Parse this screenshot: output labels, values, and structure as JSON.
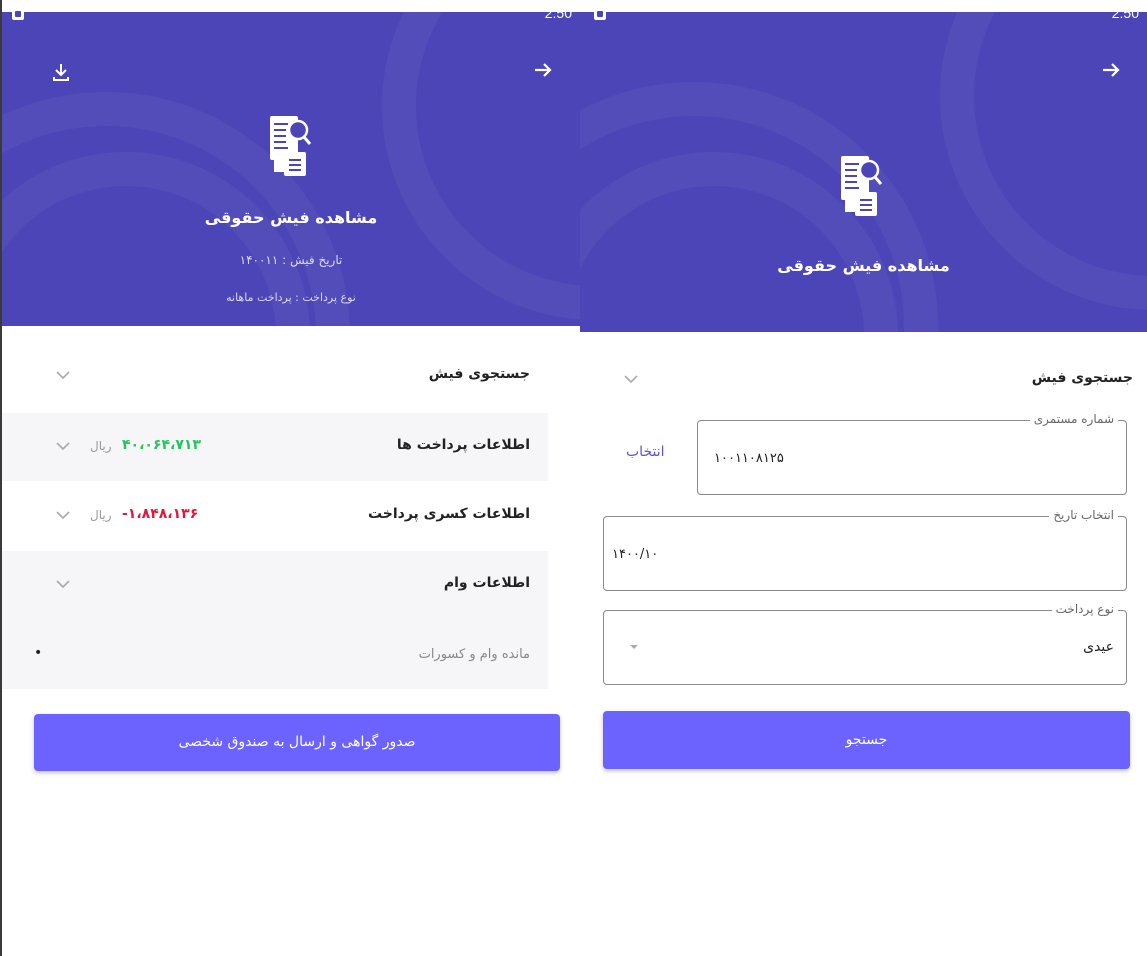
{
  "status_bar": {
    "time": "2:50"
  },
  "left_screen": {
    "title": "مشاهده فیش حقوقی",
    "receipt_date": "تاریخ فیش : ۱۴۰۰۱۱",
    "payment_type": "نوع پرداخت : پرداخت ماهانه",
    "search_section_label": "جستجوی فیش",
    "payments_label": "اطلاعات پرداخت ها",
    "payments_amount": "۴۰،۰۶۴،۷۱۳",
    "currency": "ریال",
    "deductions_label": "اطلاعات کسری پرداخت",
    "deductions_amount": "-۱،۸۴۸،۱۳۶",
    "loans_label": "اطلاعات وام",
    "loan_balance_label": "مانده وام و کسورات",
    "loan_balance_value": "•",
    "issue_button": "صدور گواهی و ارسال به صندوق شخصی"
  },
  "right_screen": {
    "title": "مشاهده فیش حقوقی",
    "search_section_label": "جستجوی فیش",
    "customer_number_label": "شماره مستمری",
    "customer_number_value": "۱۰۰۱۱۰۸۱۲۵",
    "select_link": "انتخاب",
    "date_label": "انتخاب تاریخ",
    "date_value": "۱۴۰۰/۱۰",
    "payment_type_label": "نوع پرداخت",
    "payment_type_value": "عیدی",
    "search_button": "جستجو"
  },
  "colors": {
    "header_bg": "#4c45b7",
    "button_bg": "#6c63ff",
    "positive_amount": "#22c55e",
    "negative_amount": "#e3173d",
    "link": "#5a52e0"
  },
  "icons": [
    "download-icon",
    "arrow-right-icon",
    "receipt-search-icon",
    "chevron-down-icon",
    "dropdown-arrow-icon"
  ]
}
